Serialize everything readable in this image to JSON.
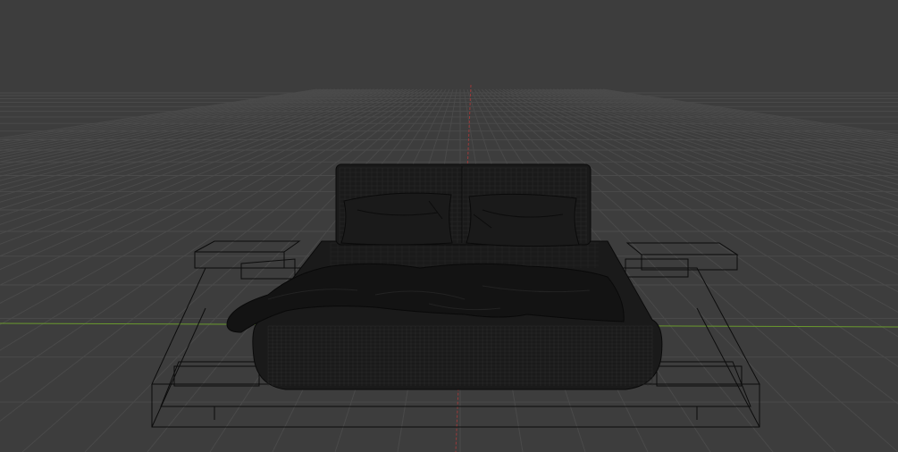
{
  "viewport": {
    "background_color": "#3d3d3d",
    "grid_color": "#4a4a4a",
    "x_axis_color": "#6a9a2e",
    "y_axis_color": "#9a3a3a",
    "wireframe_color": "#0c0c0c",
    "mesh_fill_color": "#1a1a1a"
  },
  "scene": {
    "objects": [
      {
        "name": "headboard",
        "type": "mesh"
      },
      {
        "name": "pillow-left",
        "type": "mesh"
      },
      {
        "name": "pillow-right",
        "type": "mesh"
      },
      {
        "name": "mattress",
        "type": "mesh"
      },
      {
        "name": "blanket",
        "type": "mesh"
      },
      {
        "name": "platform-base",
        "type": "mesh"
      },
      {
        "name": "side-shelf-left",
        "type": "mesh"
      },
      {
        "name": "side-shelf-right",
        "type": "mesh"
      }
    ]
  }
}
